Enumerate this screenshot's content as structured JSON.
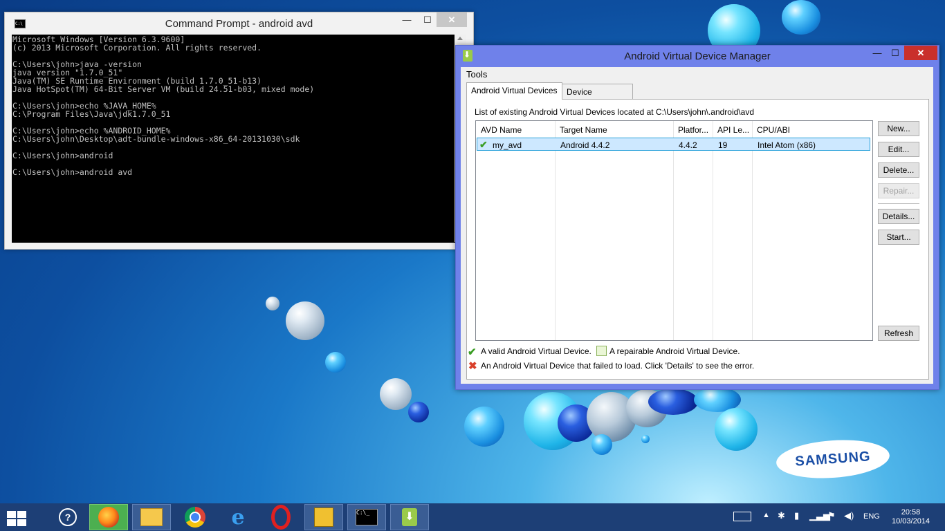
{
  "cmd": {
    "title": "Command Prompt - android  avd",
    "console_text": "Microsoft Windows [Version 6.3.9600]\n(c) 2013 Microsoft Corporation. All rights reserved.\n\nC:\\Users\\john>java -version\njava version \"1.7.0_51\"\nJava(TM) SE Runtime Environment (build 1.7.0_51-b13)\nJava HotSpot(TM) 64-Bit Server VM (build 24.51-b03, mixed mode)\n\nC:\\Users\\john>echo %JAVA_HOME%\nC:\\Program Files\\Java\\jdk1.7.0_51\n\nC:\\Users\\john>echo %ANDROID_HOME%\nC:\\Users\\john\\Desktop\\adt-bundle-windows-x86_64-20131030\\sdk\n\nC:\\Users\\john>android\n\nC:\\Users\\john>android avd",
    "icon_text": "C:\\",
    "min": "—",
    "max": "☐",
    "close": "✕"
  },
  "avd": {
    "title": "Android Virtual Device Manager",
    "menu": [
      "Tools"
    ],
    "tabs": [
      "Android Virtual Devices",
      "Device Definitions"
    ],
    "description": "List of existing Android Virtual Devices located at C:\\Users\\john\\.android\\avd",
    "columns": [
      "AVD Name",
      "Target Name",
      "Platfor...",
      "API Le...",
      "CPU/ABI"
    ],
    "rows": [
      {
        "status": "✔",
        "name": "my_avd",
        "target": "Android 4.4.2",
        "platform": "4.4.2",
        "api": "19",
        "cpu": "Intel Atom (x86)"
      }
    ],
    "buttons": {
      "new": "New...",
      "edit": "Edit...",
      "delete": "Delete...",
      "repair": "Repair...",
      "details": "Details...",
      "start": "Start...",
      "refresh": "Refresh"
    },
    "legend": {
      "valid": "A valid Android Virtual Device.",
      "repairable": "A repairable Android Virtual Device.",
      "failed": "An Android Virtual Device that failed to load. Click 'Details' to see the error."
    },
    "min": "—",
    "max": "☐",
    "close": "✕"
  },
  "wallpaper": {
    "brand": "SAMSUNG"
  },
  "taskbar": {
    "items": [
      "start-button",
      "help",
      "firefox",
      "file-explorer",
      "chrome",
      "internet-explorer",
      "opera",
      "app",
      "command-prompt",
      "android-avd-manager"
    ],
    "icons": {
      "cmd": "C:\\_",
      "help": "?"
    },
    "language": "ENG",
    "time": "20:58",
    "date": "10/03/2014"
  }
}
